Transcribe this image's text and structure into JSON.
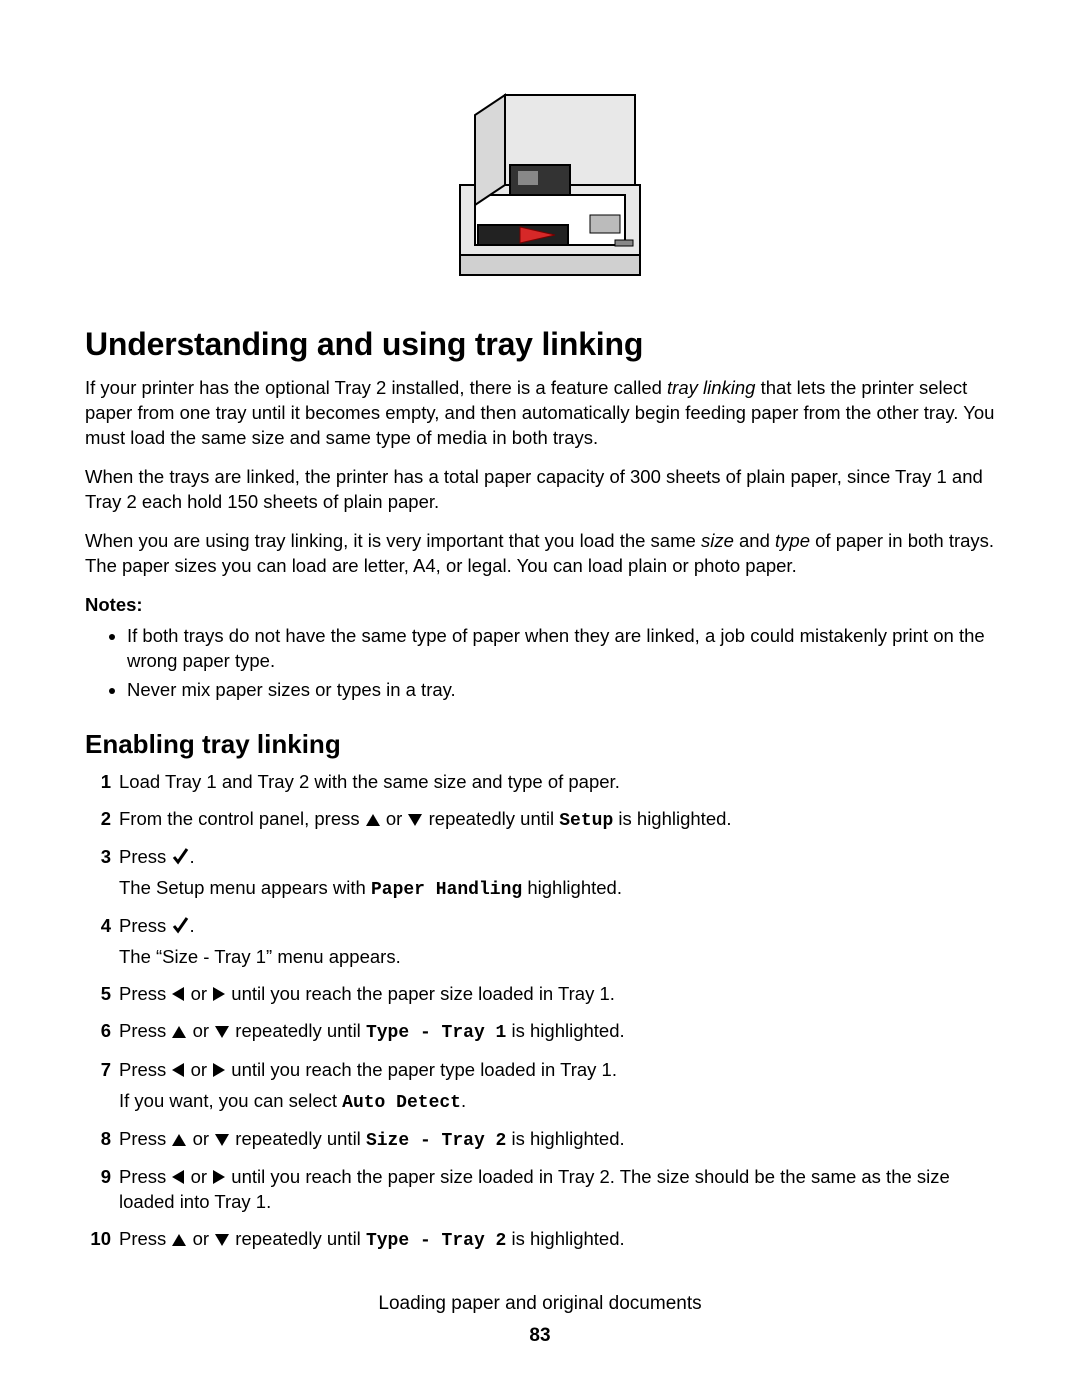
{
  "h1": "Understanding and using tray linking",
  "intro": {
    "p1_a": "If your printer has the optional Tray 2 installed, there is a feature called ",
    "p1_i": "tray linking",
    "p1_b": " that lets the printer select paper from one tray until it becomes empty, and then automatically begin feeding paper from the other tray. You must load the same size and same type of media in both trays.",
    "p2": "When the trays are linked, the printer has a total paper capacity of 300 sheets of plain paper, since Tray 1 and Tray 2 each hold 150 sheets of plain paper.",
    "p3_a": "When you are using tray linking, it is very important that you load the same ",
    "p3_i1": "size",
    "p3_b": " and ",
    "p3_i2": "type",
    "p3_c": " of paper in both trays. The paper sizes you can load are letter, A4, or legal. You can load plain or photo paper."
  },
  "notes_label": "Notes:",
  "notes": [
    "If both trays do not have the same type of paper when they are linked, a job could mistakenly print on the wrong paper type.",
    "Never mix paper sizes or types in a tray."
  ],
  "h2": "Enabling tray linking",
  "steps": {
    "s1": "Load Tray 1 and Tray 2 with the same size and type of paper.",
    "s2_a": "From the control panel, press ",
    "s2_b": " or ",
    "s2_c": " repeatedly until ",
    "s2_mono": "Setup",
    "s2_d": " is highlighted.",
    "s3_a": "Press ",
    "s3_b": ".",
    "s3_sub_a": "The Setup menu appears with ",
    "s3_sub_mono": "Paper Handling",
    "s3_sub_b": " highlighted.",
    "s4_a": "Press ",
    "s4_b": ".",
    "s4_sub": "The “Size - Tray 1” menu appears.",
    "s5_a": "Press ",
    "s5_b": " or ",
    "s5_c": " until you reach the paper size loaded in Tray 1.",
    "s6_a": "Press ",
    "s6_b": " or ",
    "s6_c": " repeatedly until ",
    "s6_mono": "Type - Tray 1",
    "s6_d": " is highlighted.",
    "s7_a": "Press ",
    "s7_b": " or ",
    "s7_c": " until you reach the paper type loaded in Tray 1.",
    "s7_sub_a": "If you want, you can select ",
    "s7_sub_mono": "Auto Detect",
    "s7_sub_b": ".",
    "s8_a": "Press ",
    "s8_b": " or ",
    "s8_c": " repeatedly until ",
    "s8_mono": "Size - Tray 2",
    "s8_d": " is highlighted.",
    "s9_a": "Press ",
    "s9_b": " or ",
    "s9_c": " until you reach the paper size loaded in Tray 2. The size should be the same as the size loaded into Tray 1.",
    "s10_a": "Press ",
    "s10_b": " or ",
    "s10_c": " repeatedly until ",
    "s10_mono": "Type - Tray 2",
    "s10_d": " is highlighted."
  },
  "footer": "Loading paper and original documents",
  "page_number": "83"
}
